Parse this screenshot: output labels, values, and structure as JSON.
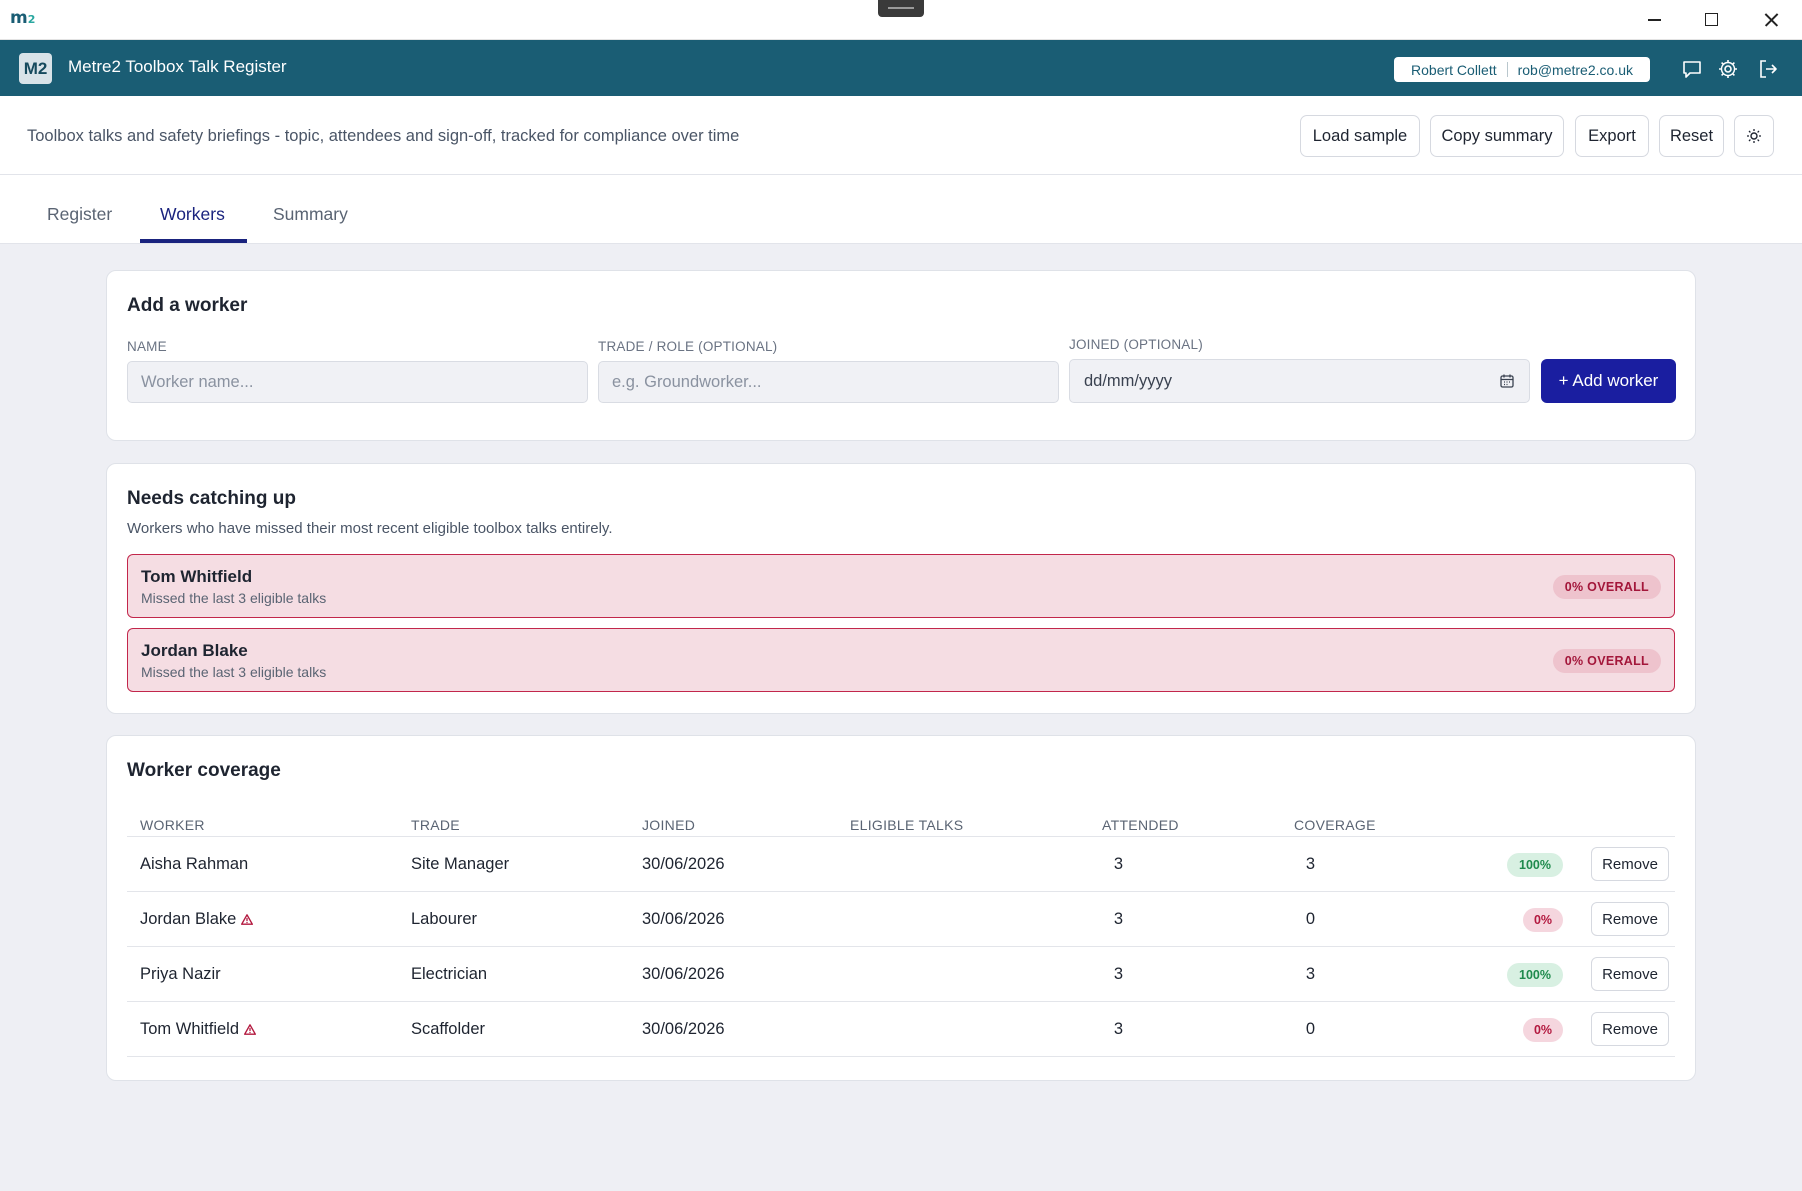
{
  "window": {
    "logo": "m",
    "logo_sub": "2"
  },
  "header": {
    "badge": "M2",
    "title": "Metre2 Toolbox Talk Register",
    "user_name": "Robert Collett",
    "user_email": "rob@metre2.co.uk"
  },
  "toolbar": {
    "tagline": "Toolbox talks and safety briefings - topic, attendees and sign-off, tracked for compliance over time",
    "load_sample": "Load sample",
    "copy_summary": "Copy summary",
    "export": "Export",
    "reset": "Reset"
  },
  "tabs": [
    {
      "label": "Register",
      "active": false
    },
    {
      "label": "Workers",
      "active": true
    },
    {
      "label": "Summary",
      "active": false
    }
  ],
  "add_worker": {
    "title": "Add a worker",
    "name_label": "NAME",
    "name_placeholder": "Worker name...",
    "trade_label": "TRADE / ROLE (OPTIONAL)",
    "trade_placeholder": "e.g. Groundworker...",
    "joined_label": "JOINED (OPTIONAL)",
    "joined_placeholder": "dd/mm/yyyy",
    "button": "+ Add worker"
  },
  "catch_up": {
    "title": "Needs catching up",
    "subtitle": "Workers who have missed their most recent eligible toolbox talks entirely.",
    "items": [
      {
        "name": "Tom Whitfield",
        "detail": "Missed the last 3 eligible talks",
        "badge": "0% OVERALL"
      },
      {
        "name": "Jordan Blake",
        "detail": "Missed the last 3 eligible talks",
        "badge": "0% OVERALL"
      }
    ]
  },
  "coverage": {
    "title": "Worker coverage",
    "columns": [
      "WORKER",
      "TRADE",
      "JOINED",
      "ELIGIBLE TALKS",
      "ATTENDED",
      "COVERAGE"
    ],
    "remove_label": "Remove",
    "rows": [
      {
        "worker": "Aisha Rahman",
        "warning": false,
        "trade": "Site Manager",
        "joined": "30/06/2026",
        "eligible": "3",
        "attended": "3",
        "coverage": "100%",
        "status": "good"
      },
      {
        "worker": "Jordan Blake",
        "warning": true,
        "trade": "Labourer",
        "joined": "30/06/2026",
        "eligible": "3",
        "attended": "0",
        "coverage": "0%",
        "status": "bad"
      },
      {
        "worker": "Priya Nazir",
        "warning": false,
        "trade": "Electrician",
        "joined": "30/06/2026",
        "eligible": "3",
        "attended": "3",
        "coverage": "100%",
        "status": "good"
      },
      {
        "worker": "Tom Whitfield",
        "warning": true,
        "trade": "Scaffolder",
        "joined": "30/06/2026",
        "eligible": "3",
        "attended": "0",
        "coverage": "0%",
        "status": "bad"
      }
    ]
  },
  "colors": {
    "header_bg": "#1a5d74",
    "primary": "#1a1ea0",
    "alert_border": "#c2264b",
    "good": "#1f8a4c",
    "bad": "#b3193f"
  }
}
